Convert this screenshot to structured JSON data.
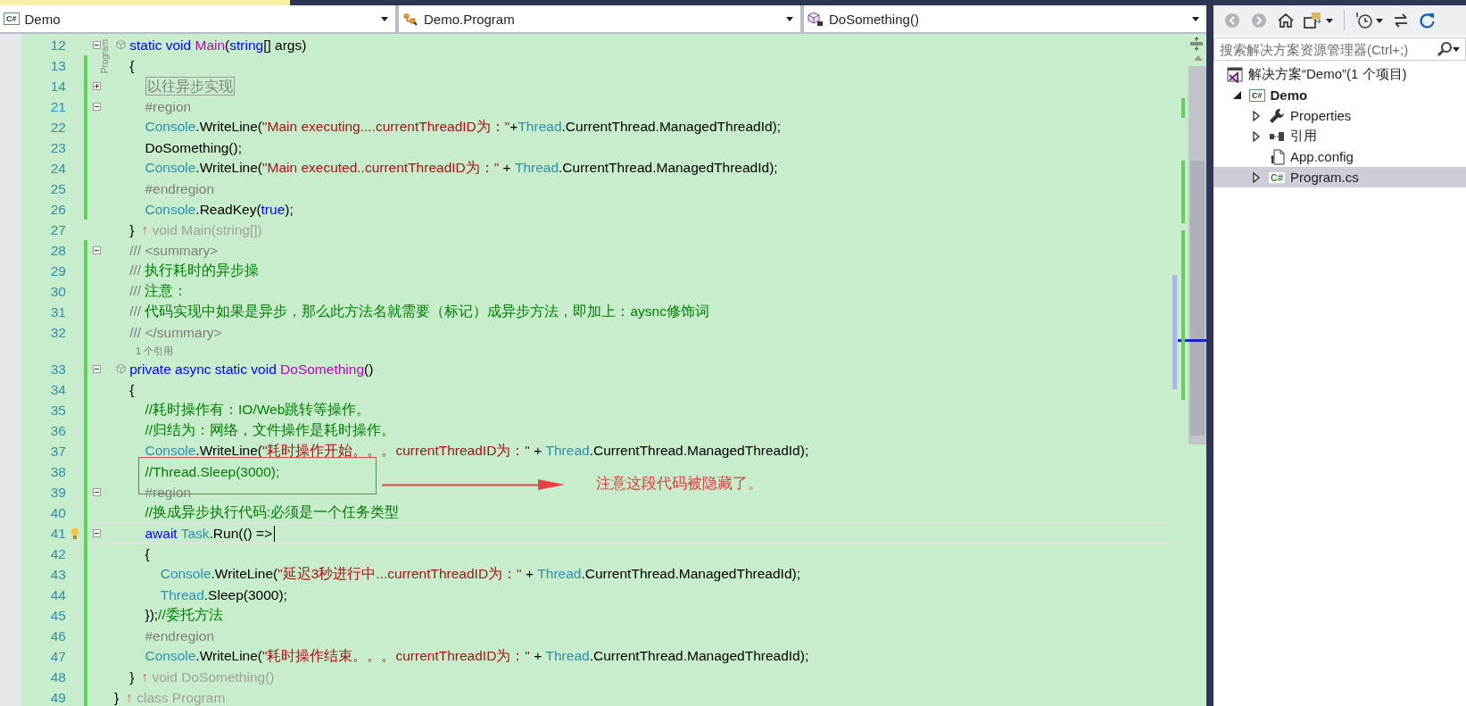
{
  "nav_bar": {
    "project": {
      "badge": "C#",
      "label": "Demo"
    },
    "type": {
      "label": "Demo.Program"
    },
    "member": {
      "label": "DoSomething()"
    }
  },
  "editor": {
    "margin_label": "Program",
    "annotation_note": "注意这段代码被隐藏了。",
    "lines": [
      {
        "kind": "code",
        "number": "12",
        "changed": false,
        "expanded": true,
        "member_glyph": true,
        "tokens": [
          {
            "kind": "kw",
            "text": "    static void "
          },
          {
            "kind": "method",
            "text": "Main"
          },
          {
            "kind": "text",
            "text": "("
          },
          {
            "kind": "kw",
            "text": "string"
          },
          {
            "kind": "text",
            "text": "[] args)"
          }
        ]
      },
      {
        "kind": "code",
        "number": "13",
        "changed": true,
        "tokens": [
          {
            "kind": "text",
            "text": "    {"
          }
        ]
      },
      {
        "kind": "code",
        "number": "14",
        "changed": true,
        "expanded": false,
        "tokens": [
          {
            "kind": "collapsed",
            "text": "以往异步实现"
          }
        ]
      },
      {
        "kind": "code",
        "number": "21",
        "changed": true,
        "expanded": true,
        "tokens": [
          {
            "kind": "pre",
            "text": "        #region"
          }
        ]
      },
      {
        "kind": "code",
        "number": "22",
        "changed": true,
        "tokens": [
          {
            "kind": "type",
            "text": "        Console"
          },
          {
            "kind": "text",
            "text": ".WriteLine("
          },
          {
            "kind": "str",
            "text": "\"Main executing....currentThreadID为：\""
          },
          {
            "kind": "text",
            "text": "+"
          },
          {
            "kind": "type",
            "text": "Thread"
          },
          {
            "kind": "text",
            "text": ".CurrentThread.ManagedThreadId);"
          }
        ]
      },
      {
        "kind": "code",
        "number": "23",
        "changed": true,
        "tokens": [
          {
            "kind": "text",
            "text": "        DoSomething();"
          }
        ]
      },
      {
        "kind": "code",
        "number": "24",
        "changed": true,
        "tokens": [
          {
            "kind": "type",
            "text": "        Console"
          },
          {
            "kind": "text",
            "text": ".WriteLine("
          },
          {
            "kind": "str",
            "text": "\"Main executed..currentThreadID为：\""
          },
          {
            "kind": "text",
            "text": " + "
          },
          {
            "kind": "type",
            "text": "Thread"
          },
          {
            "kind": "text",
            "text": ".CurrentThread.ManagedThreadId);"
          }
        ]
      },
      {
        "kind": "code",
        "number": "25",
        "changed": true,
        "tokens": [
          {
            "kind": "pre",
            "text": "        #endregion"
          }
        ]
      },
      {
        "kind": "code",
        "number": "26",
        "changed": true,
        "tokens": [
          {
            "kind": "type",
            "text": "        Console"
          },
          {
            "kind": "text",
            "text": ".ReadKey("
          },
          {
            "kind": "kw",
            "text": "true"
          },
          {
            "kind": "text",
            "text": ");"
          }
        ]
      },
      {
        "kind": "code",
        "number": "27",
        "changed": false,
        "tokens": [
          {
            "kind": "text",
            "text": "    }"
          },
          {
            "kind": "hint_arrow",
            "text": "↑"
          },
          {
            "kind": "hint",
            "text": "void Main(string[])"
          }
        ]
      },
      {
        "kind": "code",
        "number": "28",
        "changed": true,
        "expanded": true,
        "tokens": [
          {
            "kind": "doc",
            "text": "    /// <summary>"
          }
        ]
      },
      {
        "kind": "code",
        "number": "29",
        "changed": true,
        "tokens": [
          {
            "kind": "doc",
            "text": "    ///"
          },
          {
            "kind": "comment",
            "text": " 执行耗时的异步操"
          }
        ]
      },
      {
        "kind": "code",
        "number": "30",
        "changed": true,
        "tokens": [
          {
            "kind": "doc",
            "text": "    ///"
          },
          {
            "kind": "comment",
            "text": " 注意："
          }
        ]
      },
      {
        "kind": "code",
        "number": "31",
        "changed": true,
        "tokens": [
          {
            "kind": "doc",
            "text": "    ///"
          },
          {
            "kind": "comment",
            "text": " 代码实现中如果是异步，那么此方法名就需要（标记）成异步方法，即加上：aysnc修饰词"
          }
        ]
      },
      {
        "kind": "code",
        "number": "32",
        "changed": true,
        "tokens": [
          {
            "kind": "doc",
            "text": "    /// </summary>"
          }
        ]
      },
      {
        "kind": "lens",
        "changed": true,
        "text": "1 个引用"
      },
      {
        "kind": "code",
        "number": "33",
        "changed": true,
        "expanded": true,
        "member_glyph": true,
        "tokens": [
          {
            "kind": "kw",
            "text": "    private async static void "
          },
          {
            "kind": "method",
            "text": "DoSomething"
          },
          {
            "kind": "text",
            "text": "()"
          }
        ]
      },
      {
        "kind": "code",
        "number": "34",
        "changed": true,
        "tokens": [
          {
            "kind": "text",
            "text": "    {"
          }
        ]
      },
      {
        "kind": "code",
        "number": "35",
        "changed": true,
        "tokens": [
          {
            "kind": "comment",
            "text": "        //耗时操作有：IO/Web跳转等操作。"
          }
        ]
      },
      {
        "kind": "code",
        "number": "36",
        "changed": true,
        "tokens": [
          {
            "kind": "comment",
            "text": "        //归结为：网络，文件操作是耗时操作。"
          }
        ]
      },
      {
        "kind": "code",
        "number": "37",
        "changed": true,
        "tokens": [
          {
            "kind": "type",
            "text": "        Console"
          },
          {
            "kind": "text",
            "text": ".WriteLine("
          },
          {
            "kind": "str",
            "text": "\"耗时操作开始。。。currentThreadID为：\""
          },
          {
            "kind": "text",
            "text": " + "
          },
          {
            "kind": "type",
            "text": "Thread"
          },
          {
            "kind": "text",
            "text": ".CurrentThread.ManagedThreadId);"
          }
        ]
      },
      {
        "kind": "code",
        "number": "38",
        "changed": true,
        "annotated": true,
        "tokens": [
          {
            "kind": "comment",
            "text": "        //Thread.Sleep(3000);"
          }
        ]
      },
      {
        "kind": "code",
        "number": "39",
        "changed": true,
        "expanded": true,
        "tokens": [
          {
            "kind": "pre",
            "text": "        #region"
          }
        ]
      },
      {
        "kind": "code",
        "number": "40",
        "changed": true,
        "tokens": [
          {
            "kind": "comment",
            "text": "        //换成异步执行代码:必须是一个任务类型"
          }
        ]
      },
      {
        "kind": "code",
        "number": "41",
        "changed": true,
        "expanded": true,
        "current": true,
        "lightbulb": true,
        "tokens": [
          {
            "kind": "kw",
            "text": "        await "
          },
          {
            "kind": "type",
            "text": "Task"
          },
          {
            "kind": "text",
            "text": ".Run(() =>"
          }
        ]
      },
      {
        "kind": "code",
        "number": "42",
        "changed": true,
        "tokens": [
          {
            "kind": "text",
            "text": "        {"
          }
        ]
      },
      {
        "kind": "code",
        "number": "43",
        "changed": true,
        "tokens": [
          {
            "kind": "type",
            "text": "            Console"
          },
          {
            "kind": "text",
            "text": ".WriteLine("
          },
          {
            "kind": "str",
            "text": "\"延迟3秒进行中...currentThreadID为：\""
          },
          {
            "kind": "text",
            "text": " + "
          },
          {
            "kind": "type",
            "text": "Thread"
          },
          {
            "kind": "text",
            "text": ".CurrentThread.ManagedThreadId);"
          }
        ]
      },
      {
        "kind": "code",
        "number": "44",
        "changed": true,
        "tokens": [
          {
            "kind": "type",
            "text": "            Thread"
          },
          {
            "kind": "text",
            "text": ".Sleep(3000);"
          }
        ]
      },
      {
        "kind": "code",
        "number": "45",
        "changed": true,
        "tokens": [
          {
            "kind": "text",
            "text": "        });"
          },
          {
            "kind": "comment",
            "text": "//委托方法"
          }
        ]
      },
      {
        "kind": "code",
        "number": "46",
        "changed": true,
        "tokens": [
          {
            "kind": "pre",
            "text": "        #endregion"
          }
        ]
      },
      {
        "kind": "code",
        "number": "47",
        "changed": true,
        "tokens": [
          {
            "kind": "type",
            "text": "        Console"
          },
          {
            "kind": "text",
            "text": ".WriteLine("
          },
          {
            "kind": "str",
            "text": "\"耗时操作结束。。。currentThreadID为：\""
          },
          {
            "kind": "text",
            "text": " + "
          },
          {
            "kind": "type",
            "text": "Thread"
          },
          {
            "kind": "text",
            "text": ".CurrentThread.ManagedThreadId);"
          }
        ]
      },
      {
        "kind": "code",
        "number": "48",
        "changed": true,
        "tokens": [
          {
            "kind": "text",
            "text": "    }"
          },
          {
            "kind": "hint_arrow",
            "text": "↑"
          },
          {
            "kind": "hint",
            "text": "void DoSomething()"
          }
        ]
      },
      {
        "kind": "code",
        "number": "49",
        "changed": true,
        "tokens": [
          {
            "kind": "text",
            "text": "}"
          },
          {
            "kind": "hint_arrow",
            "text": "↑"
          },
          {
            "kind": "hint",
            "text": "class Program"
          }
        ]
      }
    ]
  },
  "solution_explorer": {
    "toolbar": [
      {
        "kind": "back",
        "disabled": true,
        "dropdown": false
      },
      {
        "kind": "forward",
        "disabled": true,
        "dropdown": false
      },
      {
        "kind": "home",
        "disabled": false,
        "dropdown": false
      },
      {
        "kind": "sync",
        "disabled": false,
        "dropdown": true
      },
      {
        "kind": "separator"
      },
      {
        "kind": "history",
        "disabled": false,
        "dropdown": true
      },
      {
        "kind": "switch",
        "disabled": false,
        "dropdown": false
      },
      {
        "kind": "refresh",
        "disabled": false,
        "dropdown": false
      }
    ],
    "search": {
      "placeholder": "搜索解决方案资源管理器(Ctrl+;)"
    },
    "tree": [
      {
        "kind": "solution",
        "label": "解决方案“Demo”(1 个项目)",
        "selected": false,
        "children": [
          {
            "kind": "project",
            "badge": "C#",
            "label": "Demo",
            "expanded": true,
            "selected": false,
            "children": [
              {
                "kind": "properties",
                "label": "Properties",
                "expanded": false,
                "selected": false
              },
              {
                "kind": "references",
                "label": "引用",
                "expanded": false,
                "selected": false
              },
              {
                "kind": "config",
                "label": "App.config",
                "selected": false
              },
              {
                "kind": "csharp",
                "badge": "C#",
                "label": "Program.cs",
                "expanded": false,
                "selected": true
              }
            ]
          }
        ]
      }
    ]
  }
}
